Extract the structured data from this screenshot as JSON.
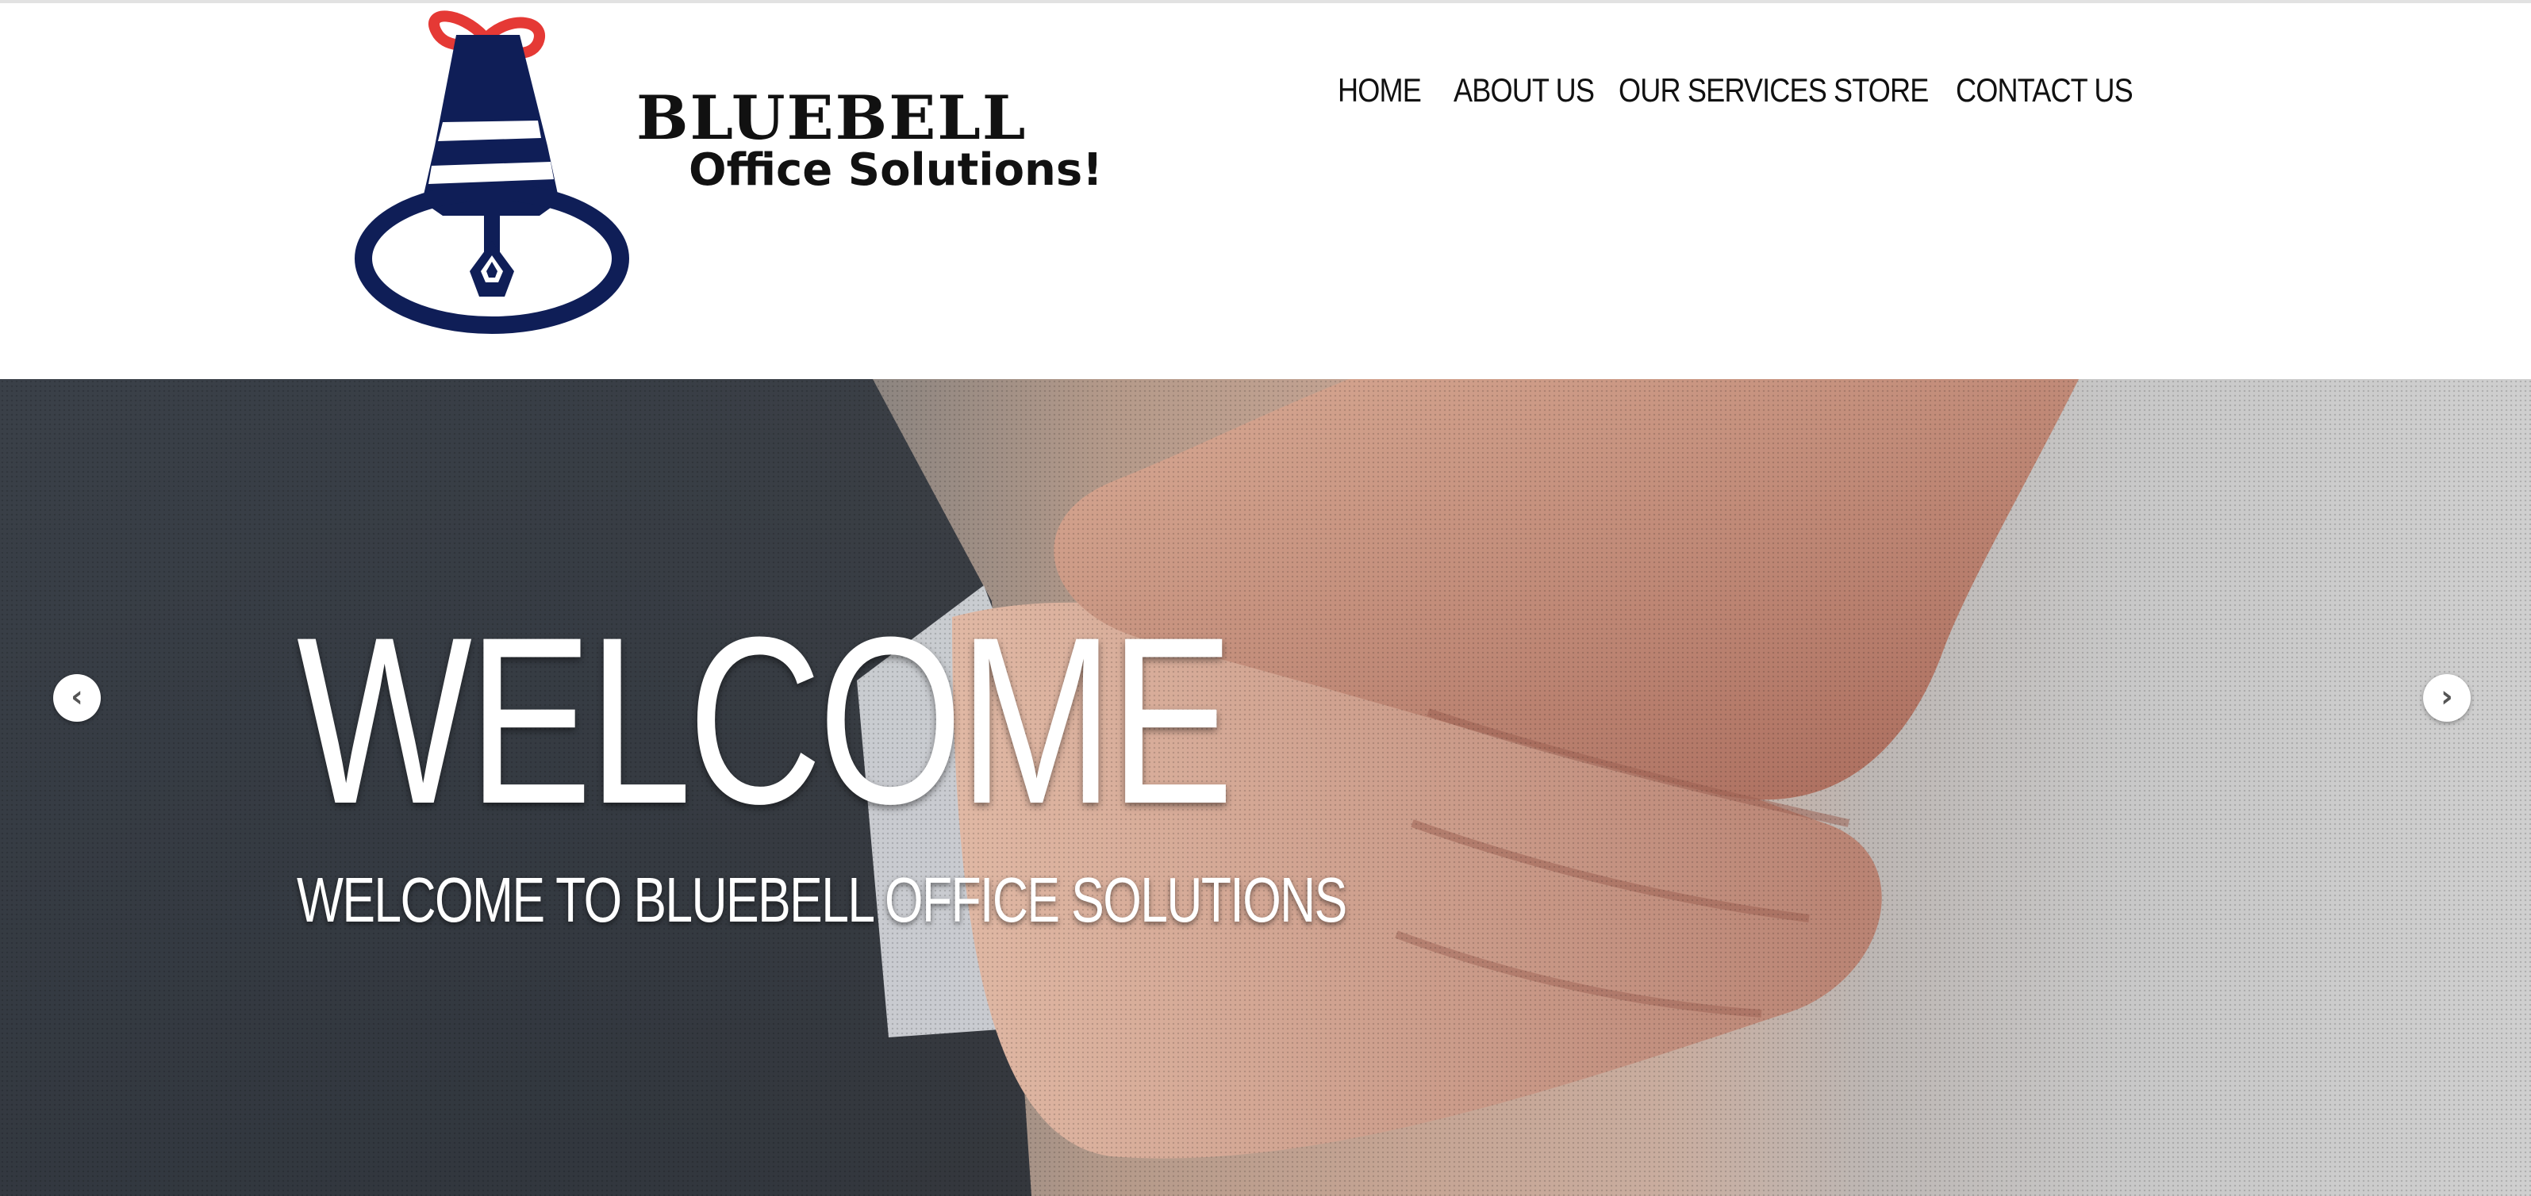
{
  "logo": {
    "line1": "BLUEBELL",
    "line2": "Office Solutions!",
    "icon": "bell-icon",
    "colors": {
      "bell": "#0f1e57",
      "ribbon": "#e53935"
    }
  },
  "nav": {
    "items": [
      {
        "label": "HOME"
      },
      {
        "label": "ABOUT US"
      },
      {
        "label": "OUR SERVICES"
      },
      {
        "label": "STORE"
      },
      {
        "label": "CONTACT US"
      }
    ]
  },
  "hero": {
    "title": "WELCOME",
    "subtitle": "WELCOME TO BLUEBELL OFFICE SOLUTIONS",
    "background": "handshake-photo",
    "prev_icon": "chevron-left-icon",
    "prev_glyph": "‹",
    "next_icon": "chevron-right-icon",
    "next_glyph": "›"
  }
}
